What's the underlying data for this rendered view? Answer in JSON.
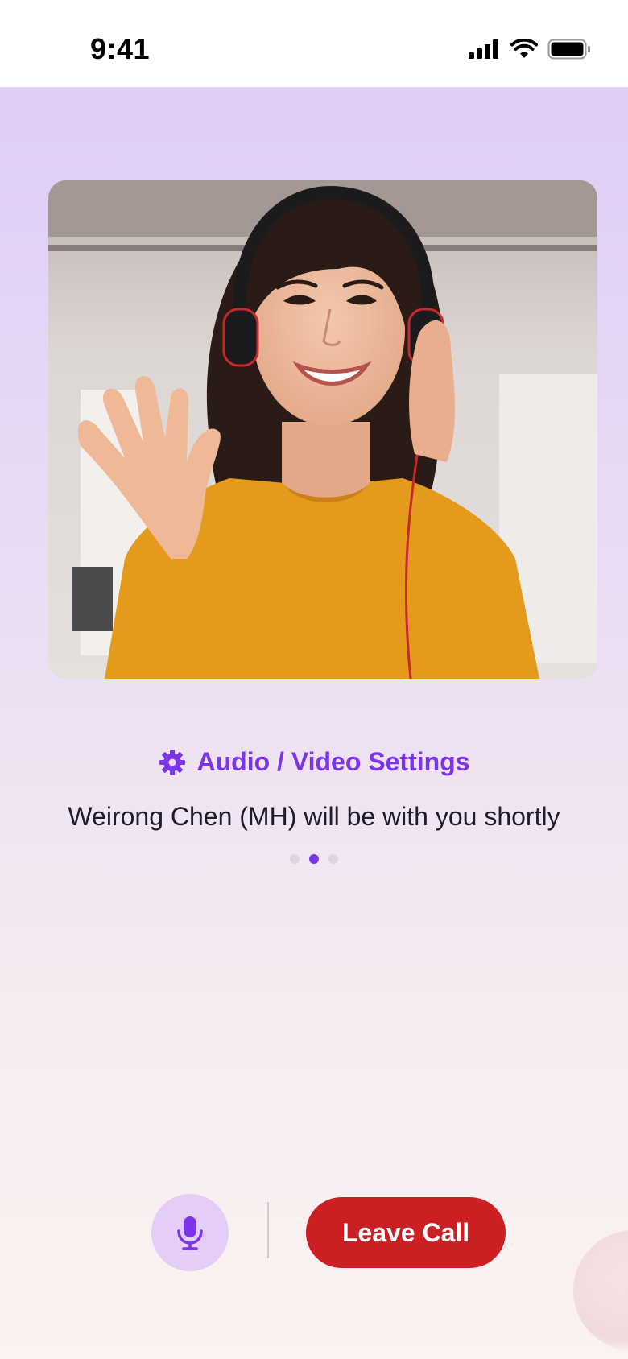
{
  "status_bar": {
    "time": "9:41",
    "icons": [
      "cellular-signal-icon",
      "wifi-icon",
      "battery-icon"
    ]
  },
  "video": {
    "participant_image": "woman-with-headset-waving"
  },
  "settings": {
    "label": "Audio / Video Settings",
    "icon": "gear-icon"
  },
  "waiting_message": "Weirong Chen (MH) will be with you shortly",
  "pager": {
    "count": 3,
    "active_index": 1
  },
  "controls": {
    "mic_icon": "microphone-icon",
    "leave_label": "Leave Call"
  },
  "colors": {
    "accent": "#7B35E8",
    "danger": "#CC1F24",
    "mic_bg": "#E4CDF6"
  }
}
